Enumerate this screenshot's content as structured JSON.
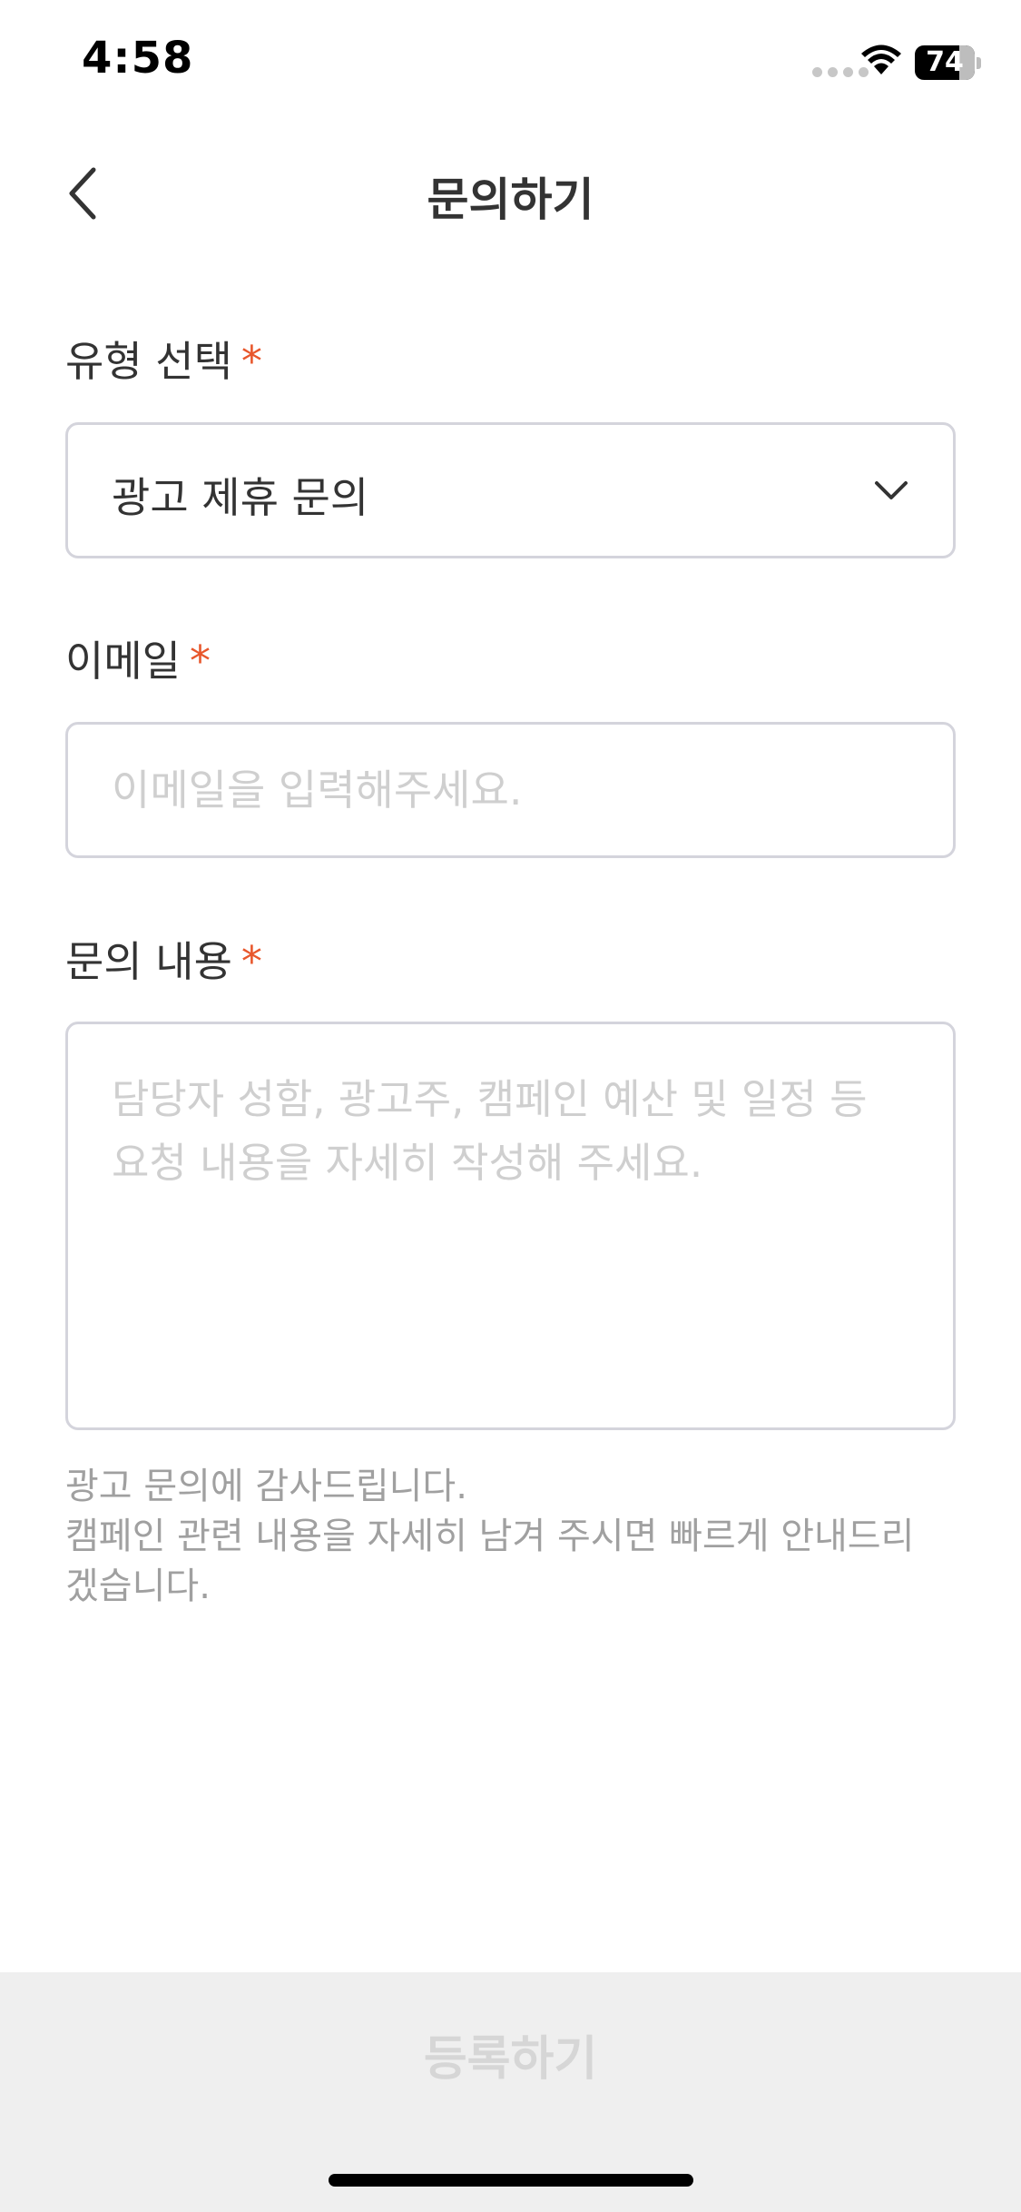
{
  "status_bar": {
    "time": "4:58",
    "battery_level": "74",
    "battery_fraction": 0.74,
    "icons": [
      "signal-icon",
      "wifi-icon",
      "battery-icon"
    ]
  },
  "header": {
    "title": "문의하기",
    "back_icon": "chevron-left-icon"
  },
  "form": {
    "type": {
      "label": "유형 선택",
      "required_mark": "*",
      "selected_value": "광고 제휴 문의",
      "icon": "chevron-down-icon"
    },
    "email": {
      "label": "이메일",
      "required_mark": "*",
      "value": "",
      "placeholder": "이메일을 입력해주세요."
    },
    "content": {
      "label": "문의 내용",
      "required_mark": "*",
      "value": "",
      "placeholder": "담당자 성함, 광고주, 캠페인 예산 및 일정 등\n요청 내용을 자세히 작성해 주세요."
    },
    "notice_lines": [
      "광고 문의에 감사드립니다.",
      "캠페인 관련 내용을 자세히 남겨 주시면 빠르게 안내드리",
      "겠습니다."
    ]
  },
  "footer": {
    "submit_label": "등록하기"
  },
  "colors": {
    "required": "#e8572c",
    "border": "#d4d4dc",
    "text_primary": "#333333",
    "placeholder": "#cfcfcf",
    "notice": "#a0a0a0",
    "submit_bg": "#efefef",
    "submit_text_disabled": "#d6d6d6"
  }
}
